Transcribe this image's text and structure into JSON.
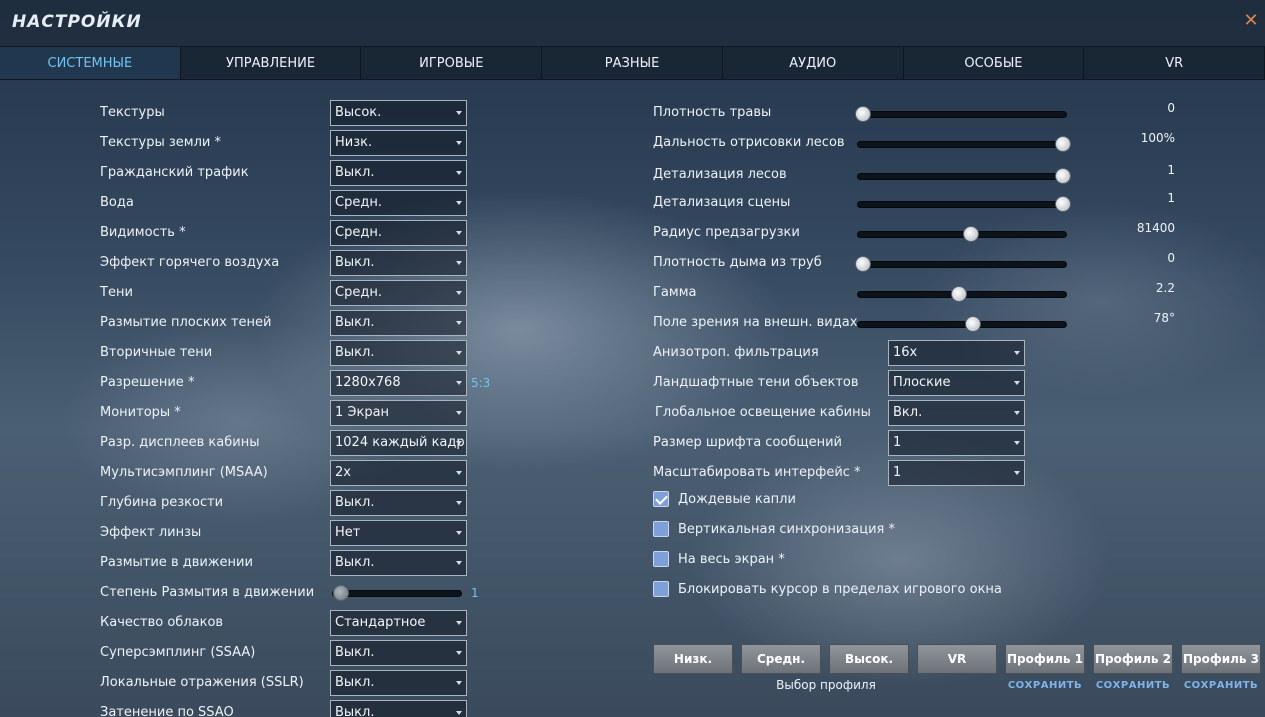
{
  "title": "НАСТРОЙКИ",
  "close_glyph": "✕",
  "tabs": [
    "СИСТЕМНЫЕ",
    "УПРАВЛЕНИЕ",
    "ИГРОВЫЕ",
    "РАЗНЫЕ",
    "АУДИО",
    "ОСОБЫЕ",
    "VR"
  ],
  "left": [
    {
      "label": "Текстуры",
      "value": "Высок."
    },
    {
      "label": "Текстуры земли *",
      "value": "Низк."
    },
    {
      "label": "Гражданский трафик",
      "value": "Выкл."
    },
    {
      "label": "Вода",
      "value": "Средн."
    },
    {
      "label": "Видимость *",
      "value": "Средн."
    },
    {
      "label": "Эффект горячего воздуха",
      "value": "Выкл."
    },
    {
      "label": "Тени",
      "value": "Средн."
    },
    {
      "label": "Размытие плоских теней",
      "value": "Выкл."
    },
    {
      "label": "Вторичные тени",
      "value": "Выкл."
    },
    {
      "label": "Разрешение *",
      "value": "1280x768"
    },
    {
      "label": "Мониторы *",
      "value": "1 Экран"
    },
    {
      "label": "Разр. дисплеев кабины",
      "value": "1024 каждый кадр"
    },
    {
      "label": "Мультисэмплинг (MSAA)",
      "value": "2x"
    },
    {
      "label": "Глубина резкости",
      "value": "Выкл."
    },
    {
      "label": "Эффект линзы",
      "value": "Нет"
    },
    {
      "label": "Размытие в движении",
      "value": "Выкл."
    },
    {
      "label": "Степень Размытия в движении",
      "slider": true
    },
    {
      "label": "Качество облаков",
      "value": "Стандартное"
    },
    {
      "label": "Суперсэмплинг (SSAA)",
      "value": "Выкл."
    },
    {
      "label": "Локальные отражения (SSLR)",
      "value": "Выкл."
    },
    {
      "label": "Затенение по SSAO",
      "value": "Выкл."
    }
  ],
  "resolution_ratio": "5:3",
  "motion_blur_slider": {
    "value": "1",
    "level": 0.0
  },
  "sliders": [
    {
      "label": "Плотность травы",
      "value": "0",
      "level": 0.0
    },
    {
      "label": "Дальность отрисовки лесов",
      "value": "100%",
      "level": 1.0
    },
    {
      "label": "Детализация лесов",
      "value": "1",
      "level": 1.0
    },
    {
      "label": "Детализация сцены",
      "value": "1",
      "level": 1.0
    },
    {
      "label": "Радиус предзагрузки",
      "value": "81400",
      "level": 0.54
    },
    {
      "label": "Плотность дыма из труб",
      "value": "0",
      "level": 0.0
    },
    {
      "label": "Гамма",
      "value": "2.2",
      "level": 0.48
    },
    {
      "label": "Поле зрения на внешн. видах",
      "value": "78°",
      "level": 0.55
    }
  ],
  "right_dropdowns": [
    {
      "label": "Анизотроп. фильтрация",
      "value": "16x"
    },
    {
      "label": "Ландшафтные тени объектов",
      "value": "Плоские"
    },
    {
      "label": "Глобальное освещение кабины",
      "value": "Вкл."
    },
    {
      "label": "Размер шрифта сообщений",
      "value": "1"
    },
    {
      "label": "Масштабировать интерфейс *",
      "value": "1"
    }
  ],
  "checkboxes": [
    {
      "label": "Дождевые капли",
      "checked": true
    },
    {
      "label": "Вертикальная синхронизация *",
      "checked": false
    },
    {
      "label": "На весь экран *",
      "checked": false
    },
    {
      "label": "Блокировать курсор в пределах игрового окна",
      "checked": false
    }
  ],
  "presets": [
    "Низк.",
    "Средн.",
    "Высок.",
    "VR"
  ],
  "profiles": [
    "Профиль 1",
    "Профиль 2",
    "Профиль 3"
  ],
  "save_label": "СОХРАНИТЬ",
  "profile_select_label": "Выбор профиля",
  "colors": {
    "accent": "#6fc4f0",
    "close": "#d8884a",
    "checkbox": "#7e9fd8",
    "save_link": "#7fb4ea"
  }
}
